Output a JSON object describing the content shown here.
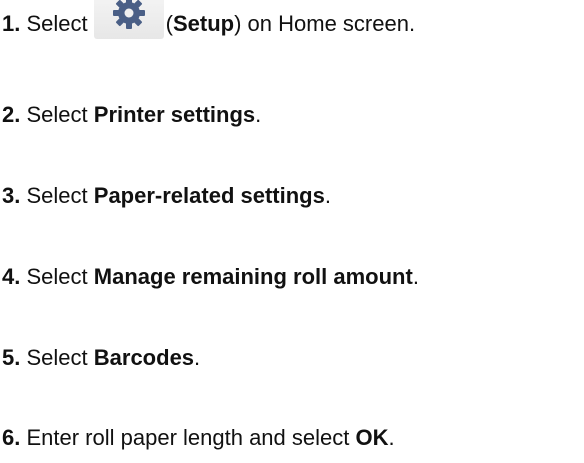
{
  "steps": [
    {
      "number": "1.",
      "before": "Select",
      "icon": "gear-icon",
      "bold": "Setup",
      "after": ") on Home screen."
    },
    {
      "number": "2.",
      "before": "Select",
      "bold": "Printer settings",
      "after": "."
    },
    {
      "number": "3.",
      "before": "Select",
      "bold": "Paper-related settings",
      "after": "."
    },
    {
      "number": "4.",
      "before": "Select",
      "bold": "Manage remaining roll amount",
      "after": "."
    },
    {
      "number": "5.",
      "before": "Select",
      "bold": "Barcodes",
      "after": "."
    },
    {
      "number": "6.",
      "before": "Enter roll paper length and select",
      "bold": "OK",
      "after": "."
    }
  ],
  "colors": {
    "text": "#111111",
    "icon": "#4a5f86"
  }
}
